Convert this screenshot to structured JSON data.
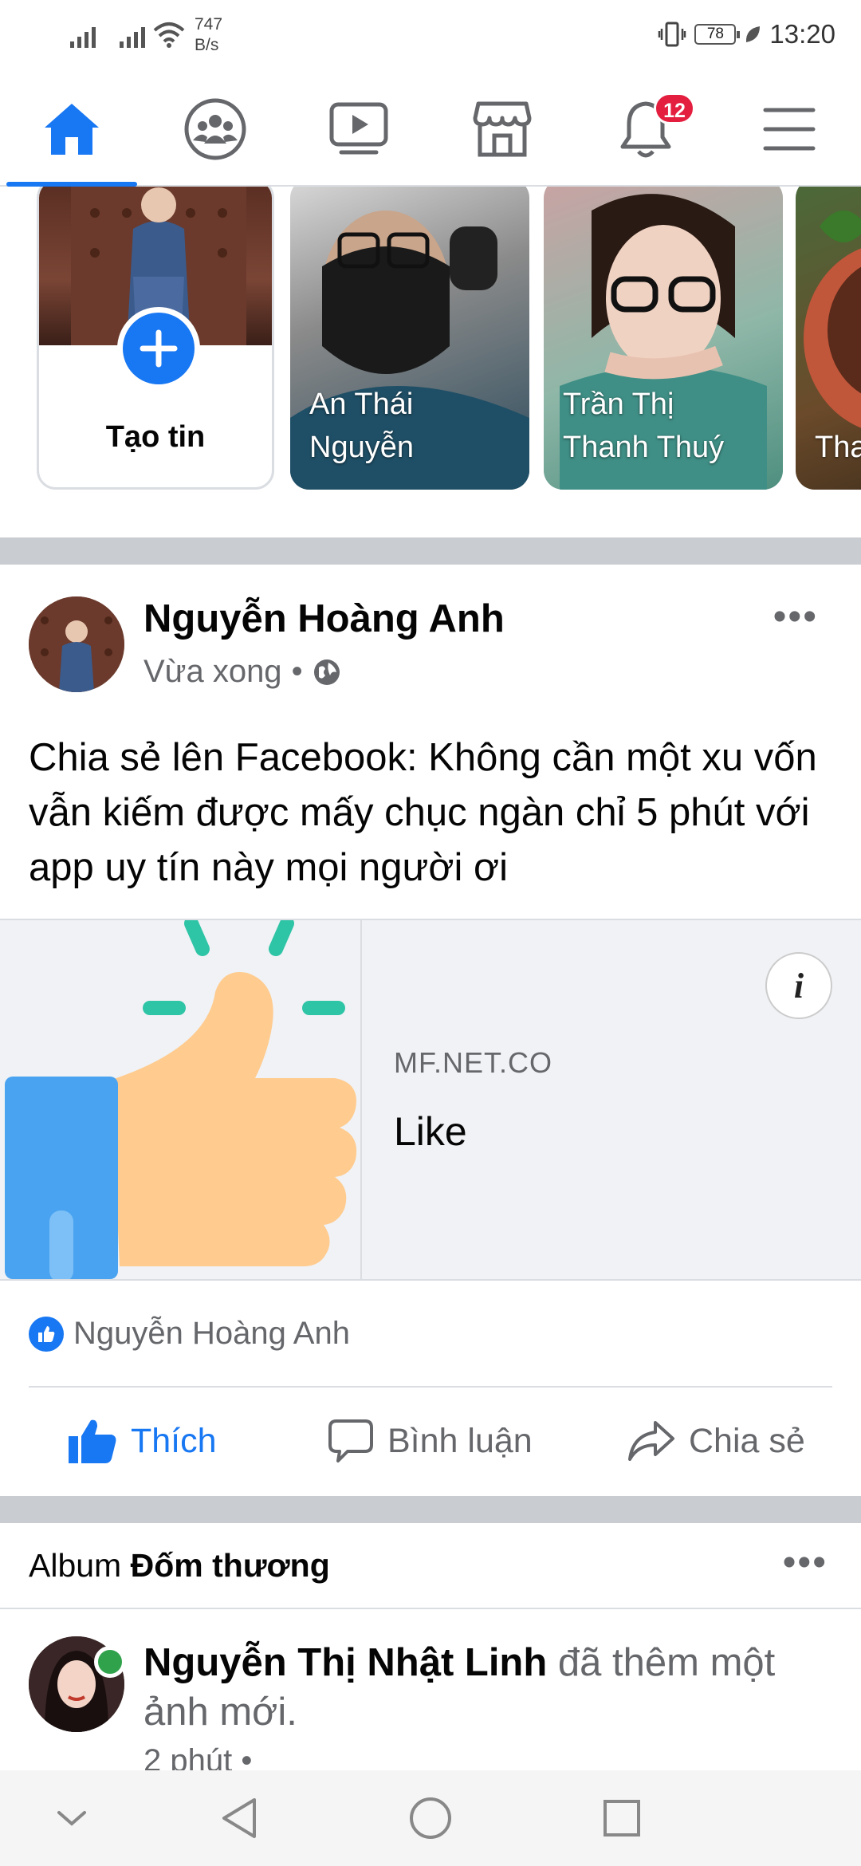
{
  "status_bar": {
    "net_speed_value": "747",
    "net_speed_unit": "B/s",
    "battery": "78",
    "time": "13:20"
  },
  "nav": {
    "notifications_badge": "12",
    "tabs": [
      "home-icon",
      "groups-icon",
      "watch-icon",
      "marketplace-icon",
      "bell-icon",
      "menu-icon"
    ]
  },
  "stories": {
    "create_label": "Tạo tin",
    "items": [
      {
        "name_line1": "An Thái",
        "name_line2": "Nguyễn"
      },
      {
        "name_line1": "Trần Thị",
        "name_line2": "Thanh Thuý"
      },
      {
        "name_line1": "Tha",
        "name_line2": ""
      }
    ]
  },
  "post": {
    "author": "Nguyễn Hoàng Anh",
    "time": "Vừa xong",
    "separator": "•",
    "text": "Chia sẻ lên Facebook: Không cần một xu vốn vẫn kiếm được mấy chục ngàn chỉ 5 phút với app uy tín này mọi người ơi",
    "link": {
      "domain": "MF.NET.CO",
      "title": "Like",
      "info_label": "i"
    },
    "reactions_name": "Nguyễn Hoàng Anh",
    "actions": {
      "like": "Thích",
      "comment": "Bình luận",
      "share": "Chia sẻ"
    }
  },
  "album_post": {
    "prefix": "Album",
    "album_name": "Đốm thương",
    "author": "Nguyễn Thị Nhật Linh",
    "action_text": "đã thêm một ảnh mới.",
    "time": "2 phút",
    "separator": "•"
  },
  "colors": {
    "accent": "#1877f2",
    "badge": "#e41e3f",
    "online": "#31a24c",
    "separator": "#c9ccd1"
  }
}
